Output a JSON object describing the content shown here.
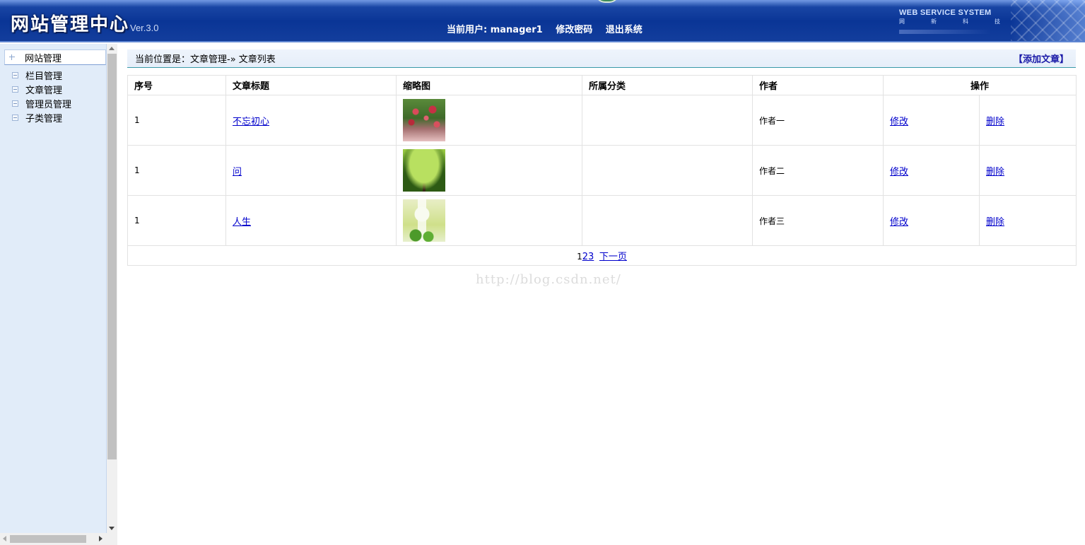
{
  "header": {
    "site_title": "网站管理中心",
    "version": "Ver.3.0",
    "current_user": "当前用户: manager1",
    "change_password": "修改密码",
    "logout": "退出系统",
    "brand_en": "WEB SERVICE SYSTEM",
    "brand_cn": "网新科技"
  },
  "sidebar": {
    "root": "网站管理",
    "items": [
      {
        "label": "栏目管理"
      },
      {
        "label": "文章管理"
      },
      {
        "label": "管理员管理"
      },
      {
        "label": "子类管理"
      }
    ]
  },
  "main": {
    "location": "当前位置是：文章管理-» 文章列表",
    "add_article": "【添加文章】",
    "columns": {
      "id": "序号",
      "title": "文章标题",
      "thumb": "缩略图",
      "category": "所属分类",
      "author": "作者",
      "ops": "操作"
    },
    "rows": [
      {
        "id": "1",
        "title": "不忘初心",
        "category": "",
        "author": "作者一",
        "edit": "修改",
        "delete": "删除"
      },
      {
        "id": "1",
        "title": "问",
        "category": "",
        "author": "作者二",
        "edit": "修改",
        "delete": "删除"
      },
      {
        "id": "1",
        "title": "人生",
        "category": "",
        "author": "作者三",
        "edit": "修改",
        "delete": "删除"
      }
    ],
    "pager": {
      "page_current": "1",
      "page_2": "2",
      "page_3": "3",
      "next": "下一页"
    },
    "watermark": "http://blog.csdn.net/"
  }
}
